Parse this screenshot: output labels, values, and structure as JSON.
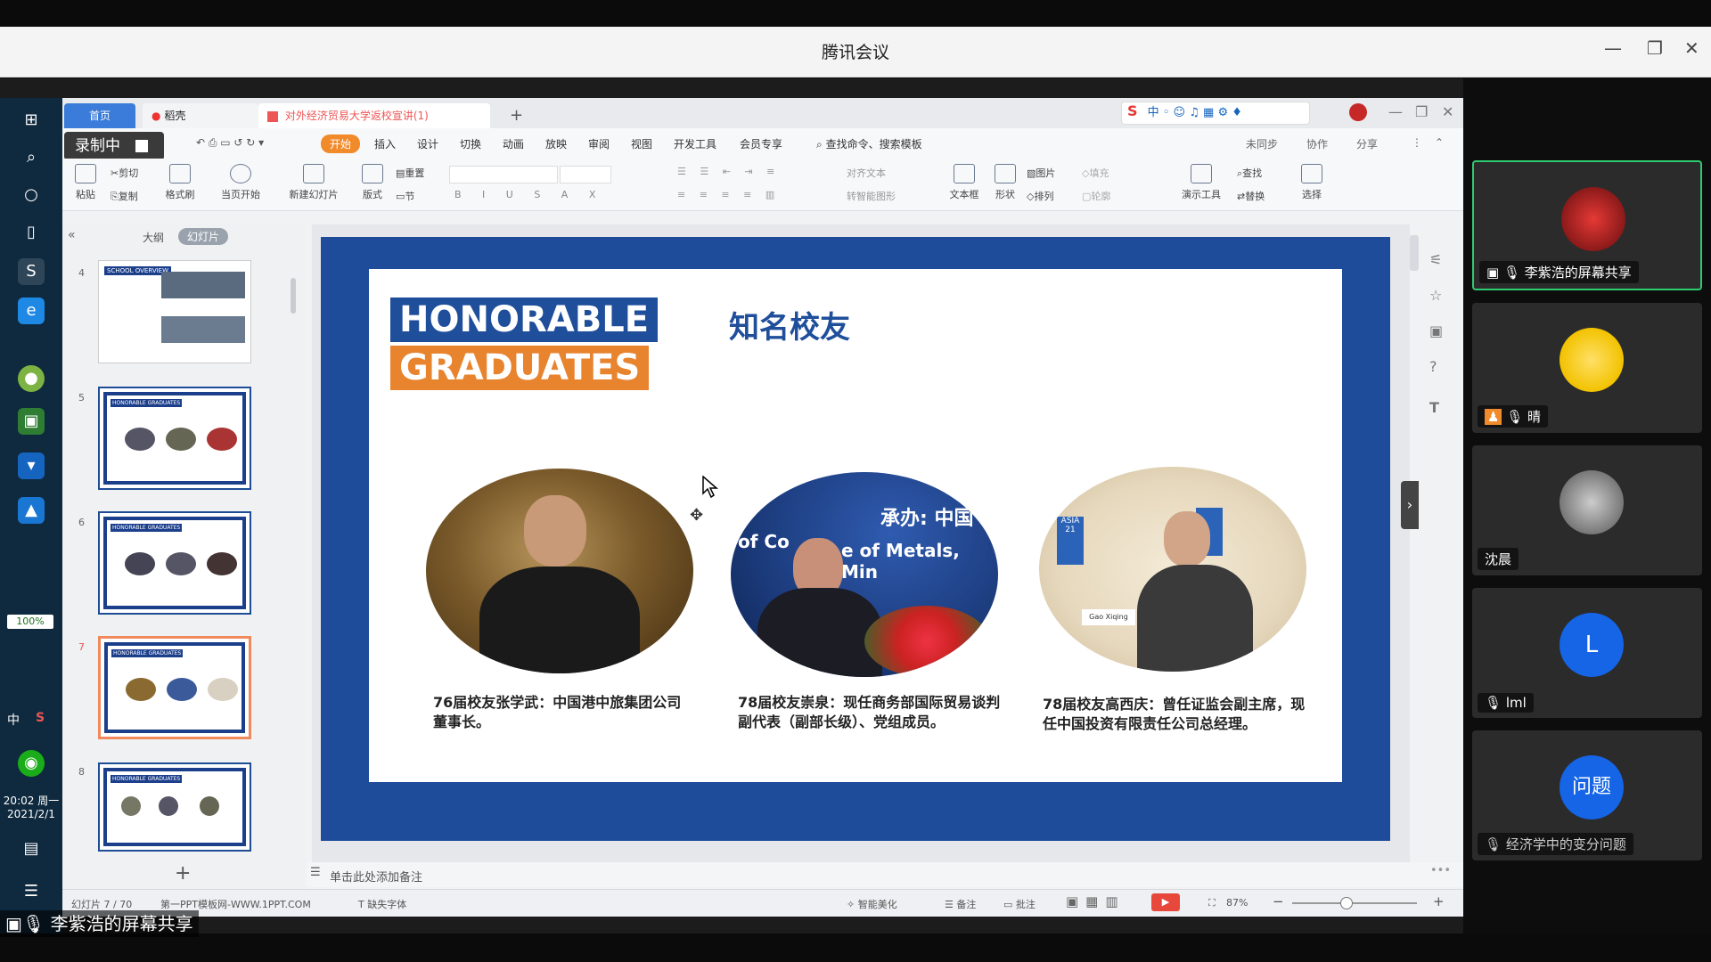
{
  "window": {
    "title": "腾讯会议",
    "controls": [
      "minimize",
      "restore",
      "close"
    ]
  },
  "wps": {
    "tabs": [
      "首页",
      "稻壳",
      "对外经济贸易大学返校宣讲(1)"
    ],
    "add_tab": "+",
    "recording_label": "录制中",
    "menu": [
      "开始",
      "插入",
      "设计",
      "切换",
      "动画",
      "放映",
      "审阅",
      "视图",
      "开发工具",
      "会员专享"
    ],
    "search_placeholder": "查找命令、搜索模板",
    "right_actions": [
      "未同步",
      "协作",
      "分享"
    ],
    "ribbon": {
      "paste": "粘贴",
      "cut": "剪切",
      "copy": "复制",
      "format_painter": "格式刷",
      "from_current": "当页开始",
      "new_slide": "新建幻灯片",
      "layout": "版式",
      "section": "节",
      "reset": "重置",
      "textbox": "文本框",
      "shape": "形状",
      "arrange": "排列",
      "picture": "图片",
      "fill": "填充",
      "outline": "轮廓",
      "presenter_tools": "演示工具",
      "find": "查找",
      "replace": "替换",
      "select": "选择",
      "align_text": "对齐文本",
      "smartart": "转智能图形"
    },
    "panel_tabs": [
      "大纲",
      "幻灯片"
    ],
    "thumbnails": [
      {
        "num": "4",
        "kind": "overview",
        "label": "SCHOOL OVERVIEW"
      },
      {
        "num": "5",
        "kind": "honorable",
        "label": "HONORABLE GRADUATES"
      },
      {
        "num": "6",
        "kind": "honorable",
        "label": "HONORABLE GRADUATES"
      },
      {
        "num": "7",
        "kind": "honorable",
        "label": "HONORABLE GRADUATES",
        "selected": true
      },
      {
        "num": "8",
        "kind": "honorable",
        "label": "HONORABLE GRADUATES"
      }
    ],
    "add_slide": "+",
    "notes_placeholder": "单击此处添加备注",
    "status": {
      "slide_counter": "幻灯片 7 / 70",
      "template": "第一PPT模板网-WWW.1PPT.COM",
      "missing_font": "缺失字体",
      "beautify": "智能美化",
      "notes": "备注",
      "comments": "批注",
      "zoom": "87%"
    }
  },
  "slide": {
    "title_en_line1": "HONORABLE",
    "title_en_line2": "GRADUATES",
    "title_cn": "知名校友",
    "colors": {
      "frame": "#1e4c9a",
      "title_blue": "#1f4e9b",
      "title_orange": "#e8832e"
    },
    "photo_texts": [
      "承办: 中国",
      "of Co",
      "e of Metals, Min",
      "ASIA 21",
      "Gao Xiqing"
    ],
    "alumni": [
      {
        "caption": "76届校友张学武：中国港中旅集团公司董事长。"
      },
      {
        "caption": "78届校友崇泉：现任商务部国际贸易谈判副代表（副部长级）、党组成员。"
      },
      {
        "caption": "78届校友高西庆：曾任证监会副主席，现任中国投资有限责任公司总经理。"
      }
    ]
  },
  "sidebar_os": {
    "battery": "100%",
    "ime_labels": [
      "中",
      "S"
    ],
    "clock_time": "20:02 周一",
    "clock_date": "2021/2/1"
  },
  "participants": [
    {
      "name": "李紫浩的屏幕共享",
      "avatar": "red-avatar",
      "sharing": true
    },
    {
      "name": "晴",
      "avatar": "pikachu-avatar"
    },
    {
      "name": "沈晨",
      "avatar": "photo-avatar"
    },
    {
      "name": "lml",
      "avatar_text": "L",
      "color": "#1565e6"
    },
    {
      "name": "经济学中的变分问题",
      "avatar_text": "问题",
      "color": "#1565e6"
    }
  ],
  "screen_share_label": "李紫浩的屏幕共享"
}
